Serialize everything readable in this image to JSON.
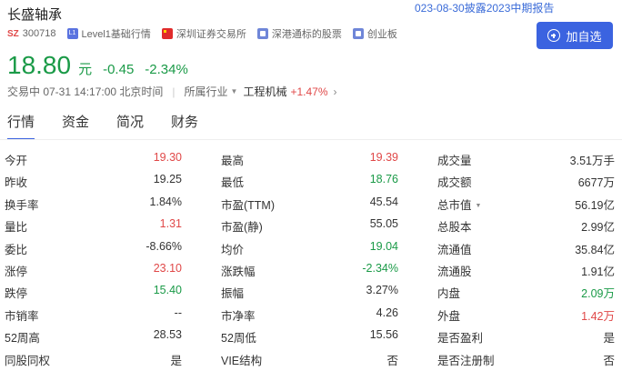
{
  "header": {
    "title": "长盛轴承",
    "report_link": "023-08-30披露2023中期报告",
    "market_badge": "SZ",
    "code": "300718",
    "l1_icon": "L1",
    "tags": [
      "Level1基础行情",
      "深圳证券交易所",
      "深港通标的股票",
      "创业板"
    ],
    "add_button": "加自选"
  },
  "quote": {
    "price": "18.80",
    "unit": "元",
    "change": "-0.45",
    "change_pct": "-2.34%"
  },
  "status": {
    "text": "交易中 07-31 14:17:00 北京时间",
    "industry_label": "所属行业",
    "industry": "工程机械",
    "industry_change": "+1.47%"
  },
  "tabs": [
    "行情",
    "资金",
    "简况",
    "财务"
  ],
  "stats": [
    [
      [
        "今开",
        "19.30"
      ],
      [
        "最高",
        "19.39"
      ],
      [
        "成交量",
        "3.51万手"
      ]
    ],
    [
      [
        "昨收",
        "19.25"
      ],
      [
        "最低",
        "18.76"
      ],
      [
        "成交额",
        "6677万"
      ]
    ],
    [
      [
        "换手率",
        "1.84%"
      ],
      [
        "市盈(TTM)",
        "45.54"
      ],
      [
        "总市值",
        "56.19亿"
      ]
    ],
    [
      [
        "量比",
        "1.31"
      ],
      [
        "市盈(静)",
        "55.05"
      ],
      [
        "总股本",
        "2.99亿"
      ]
    ],
    [
      [
        "委比",
        "-8.66%"
      ],
      [
        "均价",
        "19.04"
      ],
      [
        "流通值",
        "35.84亿"
      ]
    ],
    [
      [
        "涨停",
        "23.10"
      ],
      [
        "涨跌幅",
        "-2.34%"
      ],
      [
        "流通股",
        "1.91亿"
      ]
    ],
    [
      [
        "跌停",
        "15.40"
      ],
      [
        "振幅",
        "3.27%"
      ],
      [
        "内盘",
        "2.09万"
      ]
    ],
    [
      [
        "市销率",
        "--"
      ],
      [
        "市净率",
        "4.26"
      ],
      [
        "外盘",
        "1.42万"
      ]
    ],
    [
      [
        "52周高",
        "28.53"
      ],
      [
        "52周低",
        "15.56"
      ],
      [
        "是否盈利",
        "是"
      ]
    ],
    [
      [
        "同股同权",
        "是"
      ],
      [
        "VIE结构",
        "否"
      ],
      [
        "是否注册制",
        "否"
      ]
    ]
  ],
  "colors": {
    "up": "#e04848",
    "down": "#1a9a47",
    "accent": "#3b63e0"
  }
}
